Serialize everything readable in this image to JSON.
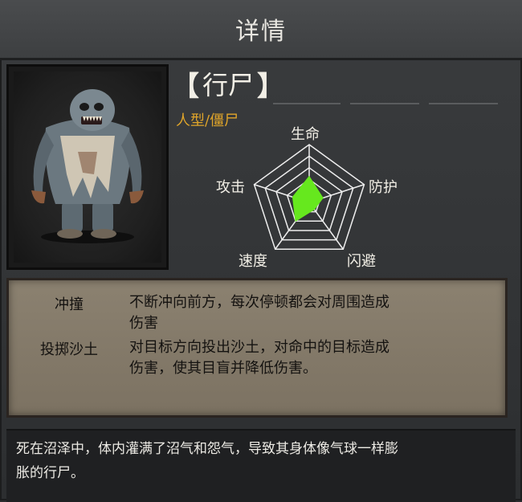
{
  "header": {
    "title": "详情"
  },
  "unit": {
    "name": "行尸",
    "bracket_left": "【",
    "bracket_right": "】",
    "subtype": "人型/僵尸"
  },
  "radar": {
    "axes": [
      "生命",
      "防护",
      "闪避",
      "速度",
      "攻击"
    ],
    "values": [
      0.45,
      0.25,
      0.15,
      0.4,
      0.3
    ],
    "fill_color": "#66e81e",
    "grid_color": "#eeeeee"
  },
  "skills": [
    {
      "name": "冲撞",
      "desc_line1": "不断冲向前方，每次停顿都会对周围造成",
      "desc_line2": "伤害"
    },
    {
      "name": "投掷沙土",
      "desc_line1": "对目标方向投出沙土，对命中的目标造成",
      "desc_line2": "伤害，使其目盲并降低伤害。"
    }
  ],
  "description": {
    "line1": "死在沼泽中，体内灌满了沼气和怨气，导致其身体像气球一样膨",
    "line2": "胀的行尸。"
  }
}
